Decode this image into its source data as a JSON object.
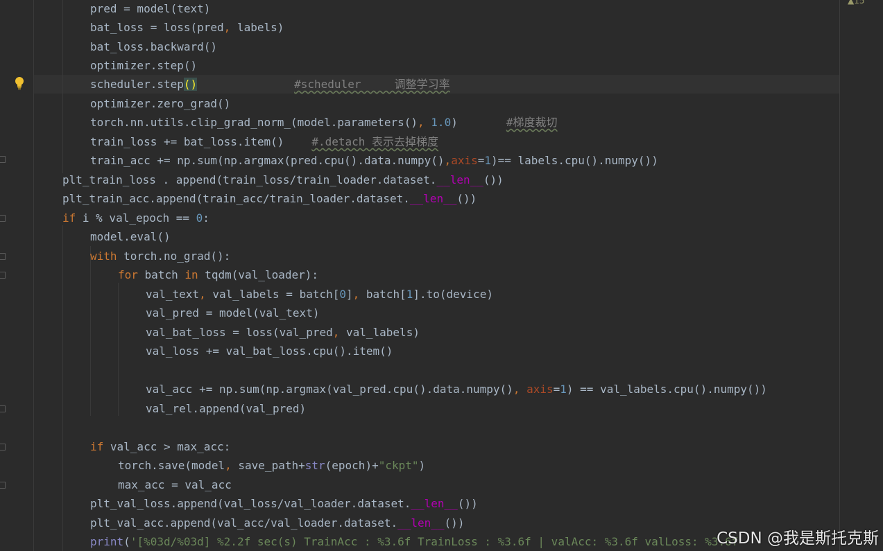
{
  "editor": {
    "top_indicator": "▲15",
    "watermark": "CSDN @我是斯托克斯",
    "lines": {
      "l1": {
        "a": "pred = model(text)"
      },
      "l2": {
        "a": "bat_loss = loss(pred",
        "b": ",",
        "c": " labels)"
      },
      "l3": {
        "a": "bat_loss.backward()"
      },
      "l4": {
        "a": "optimizer.step()"
      },
      "l5": {
        "a": "scheduler.step",
        "b": "()",
        "c": "#scheduler     调整学习率"
      },
      "l6": {
        "a": "optimizer.zero_grad()"
      },
      "l7": {
        "a": "torch.nn.utils.clip_grad_norm_(model.parameters()",
        "b": ",",
        "c": " ",
        "d": "1.0",
        "e": ")",
        "f": "#梯度裁切"
      },
      "l8": {
        "a": "train_loss += bat_loss.item()",
        "b": "#.detach 表示去掉梯度"
      },
      "l9": {
        "a": "train_acc += np.sum(np.argmax(pred.cpu().data.numpy()",
        "b": ",",
        "c": "axis",
        "d": "=",
        "e": "1",
        "f": ")== labels.cpu().numpy())"
      },
      "l10": {
        "a": "plt_train_loss . append(train_loss/train_loader.dataset.",
        "b": "__len__",
        "c": "())"
      },
      "l11": {
        "a": "plt_train_acc.append(train_acc/train_loader.dataset.",
        "b": "__len__",
        "c": "())"
      },
      "l12": {
        "a": "if",
        "b": " i % val_epoch == ",
        "c": "0",
        "d": ":"
      },
      "l13": {
        "a": "model.eval()"
      },
      "l14": {
        "a": "with",
        "b": " torch.no_grad():"
      },
      "l15": {
        "a": "for",
        "b": " batch ",
        "c": "in",
        "d": " tqdm(val_loader):"
      },
      "l16": {
        "a": "val_text",
        "b": ",",
        "c": " val_labels = batch[",
        "d": "0",
        "e": "]",
        "f": ",",
        "g": " batch[",
        "h": "1",
        "i": "].to(device)"
      },
      "l17": {
        "a": "val_pred = model(val_text)"
      },
      "l18": {
        "a": "val_bat_loss = loss(val_pred",
        "b": ",",
        "c": " val_labels)"
      },
      "l19": {
        "a": "val_loss += val_bat_loss.cpu().item()"
      },
      "l20": {
        "a": "val_acc += np.sum(np.argmax(val_pred.cpu().data.numpy()",
        "b": ",",
        "c": " ",
        "d": "axis",
        "e": "=",
        "f": "1",
        "g": ") == val_labels.cpu().numpy())"
      },
      "l21": {
        "a": "val_rel.append(val_pred)"
      },
      "l22": {
        "a": "if",
        "b": " val_acc > max_acc:"
      },
      "l23": {
        "a": "torch.save(model",
        "b": ",",
        "c": " save_path+",
        "d": "str",
        "e": "(epoch)+",
        "f": "\"ckpt\"",
        "g": ")"
      },
      "l24": {
        "a": "max_acc = val_acc"
      },
      "l25": {
        "a": "plt_val_loss.append(val_loss/val_loader.dataset.",
        "b": "__len__",
        "c": "())"
      },
      "l26": {
        "a": "plt_val_acc.append(val_acc/val_loader.dataset.",
        "b": "__len__",
        "c": "())"
      },
      "l27": {
        "a": "print",
        "b": "(",
        "c": "'[%03d/%03d] %2.2f sec(s) TrainAcc : %3.6f TrainLoss : %3.6f | valAcc: %3.6f valLoss: %3.6f"
      }
    }
  },
  "colors": {
    "background": "#2b2b2b",
    "keyword": "#cc7832",
    "number": "#6897bb",
    "dunder": "#b200b2",
    "string": "#6a8759",
    "comment": "#808080",
    "text": "#a9b7c6"
  }
}
